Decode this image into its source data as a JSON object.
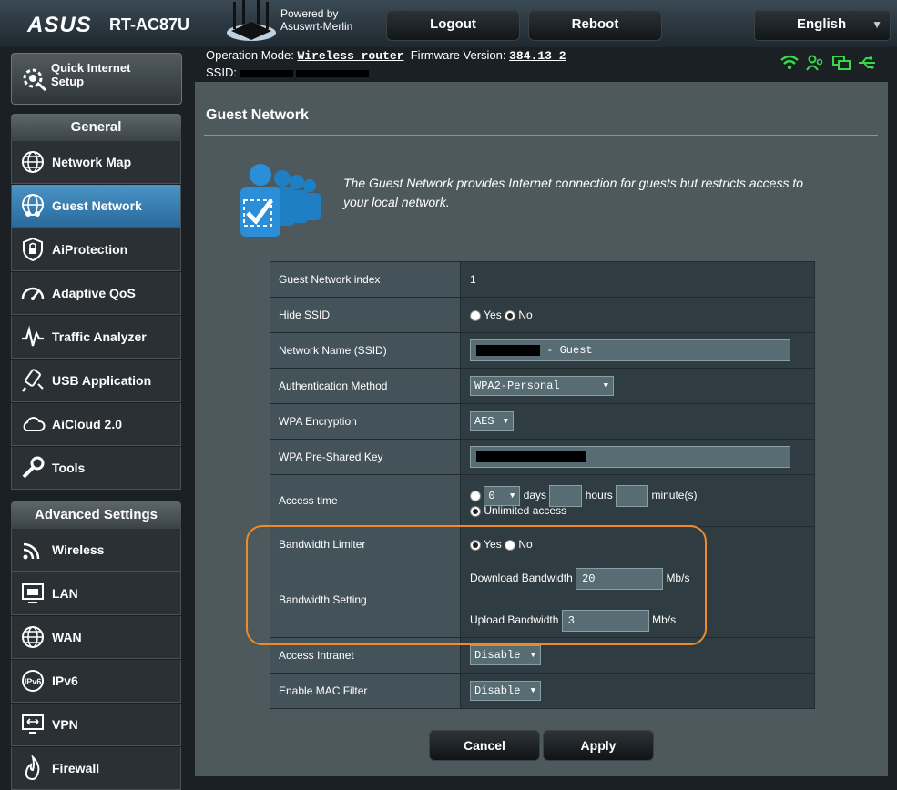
{
  "header": {
    "brand": "ASUS",
    "model": "RT-AC87U",
    "powered_by_line1": "Powered by",
    "powered_by_line2": "Asuswrt-Merlin",
    "logout_label": "Logout",
    "reboot_label": "Reboot",
    "language": "English"
  },
  "info": {
    "operation_mode_label": "Operation Mode:",
    "operation_mode_value": "Wireless router",
    "firmware_label": "Firmware Version:",
    "firmware_value": "384.13_2",
    "ssid_label": "SSID:"
  },
  "sidebar": {
    "quick_setup": "Quick Internet Setup",
    "general_header": "General",
    "general_items": [
      {
        "label": "Network Map",
        "icon": "globe-icon"
      },
      {
        "label": "Guest Network",
        "icon": "guest-globe-icon"
      },
      {
        "label": "AiProtection",
        "icon": "lock-icon"
      },
      {
        "label": "Adaptive QoS",
        "icon": "gauge-icon"
      },
      {
        "label": "Traffic Analyzer",
        "icon": "pulse-icon"
      },
      {
        "label": "USB Application",
        "icon": "usb-icon"
      },
      {
        "label": "AiCloud 2.0",
        "icon": "cloud-icon"
      },
      {
        "label": "Tools",
        "icon": "wrench-icon"
      }
    ],
    "advanced_header": "Advanced Settings",
    "advanced_items": [
      {
        "label": "Wireless",
        "icon": "wifi-icon"
      },
      {
        "label": "LAN",
        "icon": "lan-icon"
      },
      {
        "label": "WAN",
        "icon": "wan-globe-icon"
      },
      {
        "label": "IPv6",
        "icon": "ipv6-icon"
      },
      {
        "label": "VPN",
        "icon": "vpn-icon"
      },
      {
        "label": "Firewall",
        "icon": "flame-icon"
      }
    ]
  },
  "main": {
    "title": "Guest Network",
    "description": "The Guest Network provides Internet connection for guests but restricts access to your local network.",
    "fields": {
      "index_label": "Guest Network index",
      "index_value": "1",
      "hide_ssid_label": "Hide SSID",
      "yes": "Yes",
      "no": "No",
      "ssid_label": "Network Name (SSID)",
      "ssid_value": " - Guest",
      "auth_label": "Authentication Method",
      "auth_value": "WPA2-Personal",
      "wpa_enc_label": "WPA Encryption",
      "wpa_enc_value": "AES",
      "psk_label": "WPA Pre-Shared Key",
      "access_time_label": "Access time",
      "days_value": "0",
      "days": "days",
      "hours": "hours",
      "minutes": "minute(s)",
      "unlimited": "Unlimited access",
      "bw_limiter_label": "Bandwidth Limiter",
      "bw_setting_label": "Bandwidth Setting",
      "download_label": "Download Bandwidth",
      "download_value": "20",
      "upload_label": "Upload Bandwidth",
      "upload_value": "3",
      "unit": "Mb/s",
      "intranet_label": "Access Intranet",
      "intranet_value": "Disable",
      "mac_label": "Enable MAC Filter",
      "mac_value": "Disable"
    },
    "cancel_label": "Cancel",
    "apply_label": "Apply",
    "highlight_color": "#f08a28",
    "accent_color": "#4a93c6"
  }
}
